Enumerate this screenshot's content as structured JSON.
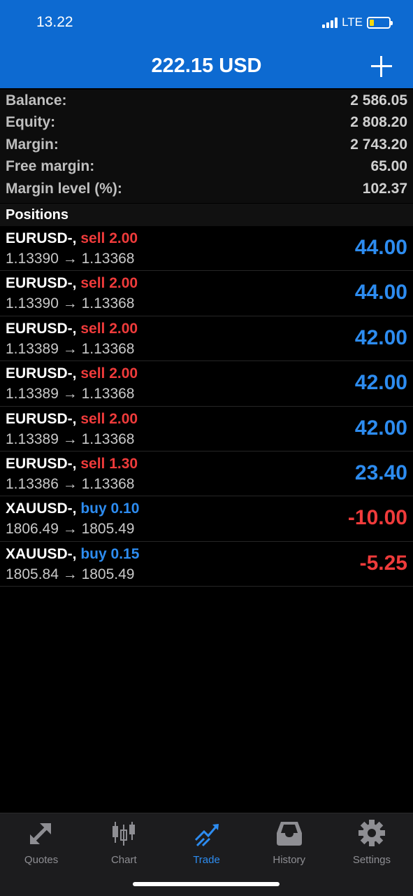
{
  "status": {
    "time": "13.22",
    "network": "LTE"
  },
  "header": {
    "title": "222.15 USD"
  },
  "summary": [
    {
      "label": "Balance:",
      "value": "2 586.05"
    },
    {
      "label": "Equity:",
      "value": "2 808.20"
    },
    {
      "label": "Margin:",
      "value": "2 743.20"
    },
    {
      "label": "Free margin:",
      "value": "65.00"
    },
    {
      "label": "Margin level (%):",
      "value": "102.37"
    }
  ],
  "positions_title": "Positions",
  "positions": [
    {
      "symbol": "EURUSD-,",
      "action": "sell 2.00",
      "side": "sell",
      "prices": "1.13390 → 1.13368",
      "profit": "44.00"
    },
    {
      "symbol": "EURUSD-,",
      "action": "sell 2.00",
      "side": "sell",
      "prices": "1.13390 → 1.13368",
      "profit": "44.00"
    },
    {
      "symbol": "EURUSD-,",
      "action": "sell 2.00",
      "side": "sell",
      "prices": "1.13389 → 1.13368",
      "profit": "42.00"
    },
    {
      "symbol": "EURUSD-,",
      "action": "sell 2.00",
      "side": "sell",
      "prices": "1.13389 → 1.13368",
      "profit": "42.00"
    },
    {
      "symbol": "EURUSD-,",
      "action": "sell 2.00",
      "side": "sell",
      "prices": "1.13389 → 1.13368",
      "profit": "42.00"
    },
    {
      "symbol": "EURUSD-,",
      "action": "sell 1.30",
      "side": "sell",
      "prices": "1.13386 → 1.13368",
      "profit": "23.40"
    },
    {
      "symbol": "XAUUSD-,",
      "action": "buy 0.10",
      "side": "buy",
      "prices": "1806.49 → 1805.49",
      "profit": "-10.00"
    },
    {
      "symbol": "XAUUSD-,",
      "action": "buy 0.15",
      "side": "buy",
      "prices": "1805.84 → 1805.49",
      "profit": "-5.25"
    }
  ],
  "tabs": [
    {
      "label": "Quotes",
      "icon": "quotes-icon"
    },
    {
      "label": "Chart",
      "icon": "chart-icon"
    },
    {
      "label": "Trade",
      "icon": "trade-icon",
      "active": true
    },
    {
      "label": "History",
      "icon": "history-icon"
    },
    {
      "label": "Settings",
      "icon": "settings-icon"
    }
  ],
  "colors": {
    "header": "#0d6ad1",
    "positive": "#2d8cf0",
    "negative": "#ef3b3b"
  }
}
